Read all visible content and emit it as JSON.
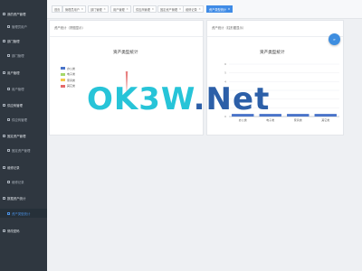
{
  "sidebar": {
    "items": [
      {
        "label": "我的资产管理",
        "level": "top"
      },
      {
        "label": "管理员用户",
        "level": "sub"
      },
      {
        "label": "部门管理",
        "level": "top"
      },
      {
        "label": "部门管理",
        "level": "sub"
      },
      {
        "label": "用户管理",
        "level": "top"
      },
      {
        "label": "用户管理",
        "level": "sub"
      },
      {
        "label": "供应商管理",
        "level": "top"
      },
      {
        "label": "供应商管理",
        "level": "sub"
      },
      {
        "label": "固定资产管理",
        "level": "top"
      },
      {
        "label": "固定资产管理",
        "level": "sub"
      },
      {
        "label": "维修记录",
        "level": "top"
      },
      {
        "label": "维修记录",
        "level": "sub"
      },
      {
        "label": "数据资产统计",
        "level": "top"
      },
      {
        "label": "资产类型统计",
        "level": "active"
      },
      {
        "label": "修改密码",
        "level": "top"
      }
    ]
  },
  "tabs": [
    {
      "label": "首页"
    },
    {
      "label": "管理员用户"
    },
    {
      "label": "部门管理"
    },
    {
      "label": "用户管理"
    },
    {
      "label": "供应商管理"
    },
    {
      "label": "固定资产管理"
    },
    {
      "label": "维修记录"
    },
    {
      "label": "资产类型统计"
    }
  ],
  "active_tab": 7,
  "left_panel": {
    "header": "资产统计（饼图显示）",
    "chart_title": "资产类型统计"
  },
  "right_panel": {
    "header": "资产统计（柱形图显示）",
    "chart_title": "资产类型统计"
  },
  "chart_data": [
    {
      "type": "pie",
      "title": "资产类型统计",
      "categories": [
        "办公类",
        "电子类",
        "家具类",
        "其它类"
      ],
      "values": [
        0,
        0,
        0,
        1
      ],
      "colors": [
        "#4a74c9",
        "#a5d86a",
        "#f3c84b",
        "#e46a6a"
      ],
      "legend_position": "left"
    },
    {
      "type": "bar",
      "title": "资产类型统计",
      "categories": [
        "办公类",
        "电子类",
        "家具类",
        "其它类"
      ],
      "values": [
        0.3,
        0.3,
        0.3,
        0.3
      ],
      "ylim": [
        0,
        6
      ],
      "yticks": [
        "0",
        "1",
        "2",
        "3",
        "4",
        "5",
        "6"
      ],
      "grid": true,
      "color": "#4a74c9"
    }
  ],
  "watermark": {
    "text": "OK3W.Net",
    "color_ok3w": "#27c4d8",
    "color_net": "#2c5fa8"
  },
  "colors": {
    "sidebar_bg": "#2f3740",
    "accent": "#3f8be6"
  },
  "icons": {
    "fab": "refresh-icon"
  }
}
